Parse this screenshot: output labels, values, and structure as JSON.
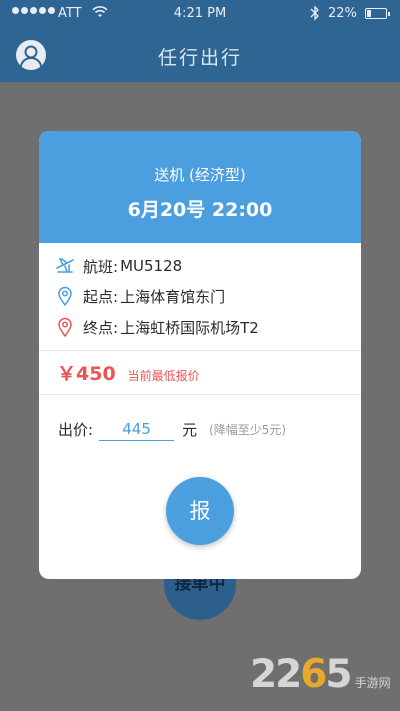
{
  "status_bar": {
    "carrier": "ATT",
    "time": "4:21 PM",
    "battery": "22%",
    "battery_level": 0.22
  },
  "nav": {
    "title": "任行出行"
  },
  "background_button": {
    "label": "接单中"
  },
  "card": {
    "service_type": "送机 (经济型)",
    "datetime": "6月20号  22:00",
    "flight": {
      "label": "航班:",
      "value": "MU5128"
    },
    "origin": {
      "label": "起点:",
      "value": "上海体育馆东门"
    },
    "destination": {
      "label": "终点:",
      "value": "上海虹桥国际机场T2"
    },
    "lowest_price": "￥450",
    "lowest_price_note": "当前最低报价",
    "bid": {
      "label": "出价:",
      "value": "445",
      "unit": "元",
      "note": "(降幅至少5元)"
    },
    "submit_label": "报"
  },
  "colors": {
    "primary": "#4c9fdf",
    "navbar": "#2f6592",
    "price": "#ec5454"
  },
  "watermark": {
    "number": "2265",
    "text": "手游网"
  }
}
